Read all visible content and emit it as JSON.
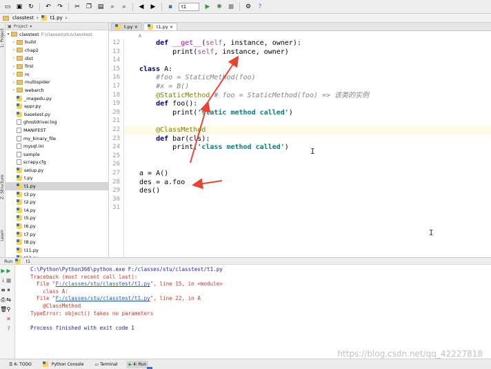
{
  "navbar": {
    "project": "classtest",
    "file": "t1.py"
  },
  "project_panel": {
    "header": "Project",
    "root_name": "classtest",
    "root_path": "F:\\classes\\stu\\classtest",
    "items": [
      {
        "label": "build",
        "kind": "folder"
      },
      {
        "label": "chap2",
        "kind": "folder"
      },
      {
        "label": "dist",
        "kind": "folder"
      },
      {
        "label": "first",
        "kind": "folder"
      },
      {
        "label": "m",
        "kind": "folder"
      },
      {
        "label": "multispider",
        "kind": "folder"
      },
      {
        "label": "webarch",
        "kind": "folder"
      },
      {
        "label": "_magedu.py",
        "kind": "py"
      },
      {
        "label": "appr.py",
        "kind": "py"
      },
      {
        "label": "basetest.py",
        "kind": "py"
      },
      {
        "label": "ghostdriver.log",
        "kind": "txt"
      },
      {
        "label": "MANIFEST",
        "kind": "txt"
      },
      {
        "label": "my_binary_file",
        "kind": "txt"
      },
      {
        "label": "mysql.ini",
        "kind": "txt"
      },
      {
        "label": "sample",
        "kind": "txt"
      },
      {
        "label": "scrapy.cfg",
        "kind": "txt"
      },
      {
        "label": "setup.py",
        "kind": "py"
      },
      {
        "label": "t.py",
        "kind": "py"
      },
      {
        "label": "t1.py",
        "kind": "py",
        "selected": true
      },
      {
        "label": "t3.py",
        "kind": "py"
      },
      {
        "label": "t2.py",
        "kind": "py"
      },
      {
        "label": "t4.py",
        "kind": "py"
      },
      {
        "label": "t5.py",
        "kind": "py"
      },
      {
        "label": "t6.py",
        "kind": "py"
      },
      {
        "label": "t7.py",
        "kind": "py"
      },
      {
        "label": "t8.py",
        "kind": "py"
      },
      {
        "label": "t11.py",
        "kind": "py"
      },
      {
        "label": "t12.py",
        "kind": "py"
      }
    ]
  },
  "editor": {
    "tabs": [
      {
        "label": "t.py",
        "active": false
      },
      {
        "label": "t1.py",
        "active": true
      }
    ],
    "breadcrumb": "A",
    "line_numbers": [
      "12",
      "13",
      "14",
      "15",
      "16",
      "17",
      "18",
      "19",
      "20",
      "21",
      "22",
      "23",
      "24",
      "25",
      "26",
      "27",
      "28",
      "29",
      "30",
      "31"
    ],
    "highlighted_line": "22"
  },
  "run_panel": {
    "header_label": "Run",
    "config_name": "t1",
    "lines": [
      {
        "text": "C:\\Python\\Python366\\python.exe F:/classes/stu/classtest/t1.py",
        "kind": "cmd"
      },
      {
        "text": "Traceback (most recent call last):",
        "kind": "err"
      },
      {
        "text": "  File \"F:/classes/stu/classtest/t1.py\", line 15, in <module>",
        "kind": "err"
      },
      {
        "text": "    class A:",
        "kind": "err"
      },
      {
        "text": "  File \"F:/classes/stu/classtest/t1.py\", line 22, in A",
        "kind": "err"
      },
      {
        "text": "    @ClassMethod",
        "kind": "err"
      },
      {
        "text": "TypeError: object() takes no parameters",
        "kind": "err"
      },
      {
        "text": "",
        "kind": "blank"
      },
      {
        "text": "Process finished with exit code 1",
        "kind": "exit"
      }
    ]
  },
  "statusbar": {
    "items": [
      "6: TODO",
      "Python Console",
      "Terminal",
      "4: Run"
    ]
  },
  "watermark": "https://blog.csdn.net/qq_42227818",
  "colors": {
    "keyword": "#000080",
    "string": "#008080",
    "comment": "#808080",
    "decorator": "#808000",
    "arrow": "#e8442f"
  }
}
